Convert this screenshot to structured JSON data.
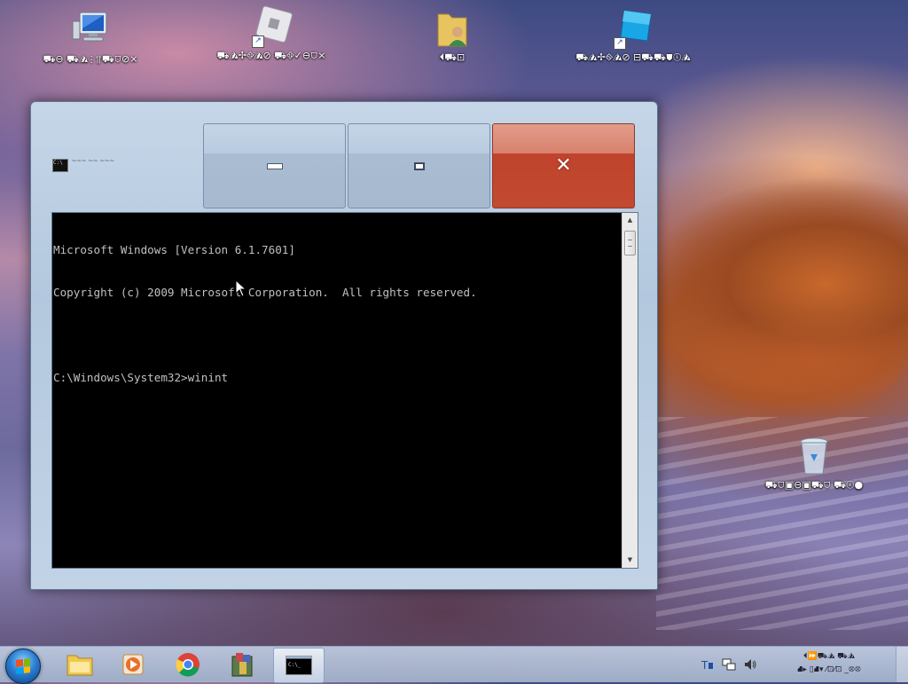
{
  "desktop": {
    "icons": [
      {
        "label": "⛟⊖ ⛟⛰⫶⥣⛟⛉⊘⨯"
      },
      {
        "label": "⛟⛰✢⛗⛰⊘ ⛟⛗✓⊖⛉⨯"
      },
      {
        "label": "⏴⛟⊡"
      },
      {
        "label": "⛟⛰✢⛗⛰⊘ ⊟⛟⛟⛊ⓘ⛰"
      },
      {
        "label": "⛟⛉▣⊖▣⛟⛉ ⛟ⓘ●"
      }
    ]
  },
  "window": {
    "title": "⁓⁓⁓ ⁓⁓ ⁓⁓⁓",
    "minimize_symbol": "",
    "maximize_symbol": "",
    "close_symbol": "✕",
    "console_lines": [
      "Microsoft Windows [Version 6.1.7601]",
      "Copyright (c) 2009 Microsoft Corporation.  All rights reserved.",
      "",
      "C:\\Windows\\System32>winint"
    ],
    "scroll_up": "▲",
    "scroll_down": "▼"
  },
  "taskbar": {
    "tray": {
      "clock_line1": "⏴⏩⛟⛰ ⛟⛰",
      "clock_line2": "⛘▸ ▯⛘▾ ⁄⊡⁄⊡ _⛒⛒"
    }
  },
  "colors": {
    "console_bg": "#000000",
    "console_fg": "#c0c0c0",
    "close_button": "#c0432c"
  }
}
